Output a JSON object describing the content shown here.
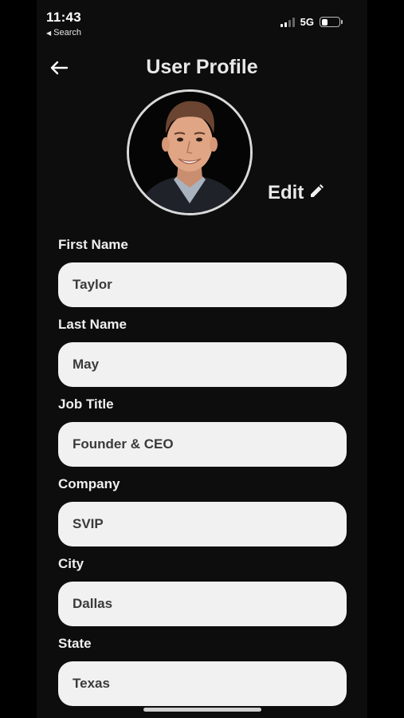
{
  "status_bar": {
    "time": "11:43",
    "back_label": "Search",
    "network": "5G"
  },
  "header": {
    "title": "User Profile",
    "back_icon": "arrow-left-icon"
  },
  "profile": {
    "edit_label": "Edit",
    "edit_icon": "pencil-icon"
  },
  "fields": [
    {
      "label": "First Name",
      "value": "Taylor"
    },
    {
      "label": "Last Name",
      "value": "May"
    },
    {
      "label": "Job Title",
      "value": "Founder & CEO"
    },
    {
      "label": "Company",
      "value": "SVIP"
    },
    {
      "label": "City",
      "value": "Dallas"
    },
    {
      "label": "State",
      "value": "Texas"
    }
  ],
  "colors": {
    "background": "#0d0d0d",
    "input_background": "#f1f1f1",
    "input_text": "#3a3a3a"
  }
}
